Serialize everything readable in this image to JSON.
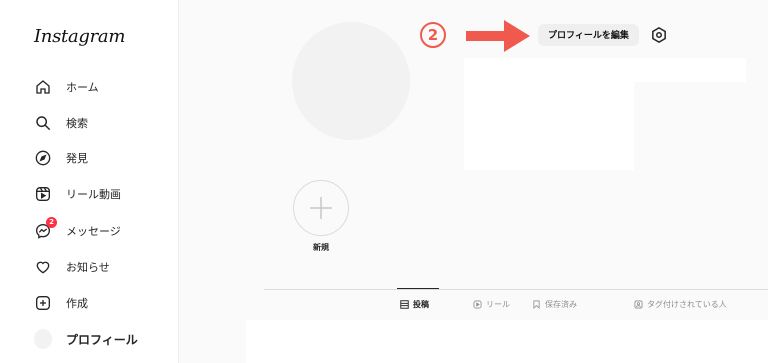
{
  "app": {
    "logo_text": "Instagram"
  },
  "sidebar": {
    "items": [
      {
        "label": "ホーム",
        "icon": "home-icon"
      },
      {
        "label": "検索",
        "icon": "search-icon"
      },
      {
        "label": "発見",
        "icon": "compass-icon"
      },
      {
        "label": "リール動画",
        "icon": "reels-icon"
      },
      {
        "label": "メッセージ",
        "icon": "messenger-icon",
        "badge": "2"
      },
      {
        "label": "お知らせ",
        "icon": "heart-icon"
      },
      {
        "label": "作成",
        "icon": "plus-square-icon"
      },
      {
        "label": "プロフィール",
        "icon": "avatar"
      }
    ]
  },
  "profile": {
    "step_number": "2",
    "edit_button": "プロフィールを編集",
    "settings_icon": "gear-icon",
    "annotation_color": "#f05a4e"
  },
  "highlights": {
    "new_label": "新規"
  },
  "tabs": [
    {
      "label": "投稿",
      "icon": "grid-icon",
      "active": true
    },
    {
      "label": "リール",
      "icon": "reels-small-icon",
      "active": false
    },
    {
      "label": "保存済み",
      "icon": "bookmark-icon",
      "active": false
    },
    {
      "label": "タグ付けされている人",
      "icon": "tagged-icon",
      "active": false
    }
  ]
}
